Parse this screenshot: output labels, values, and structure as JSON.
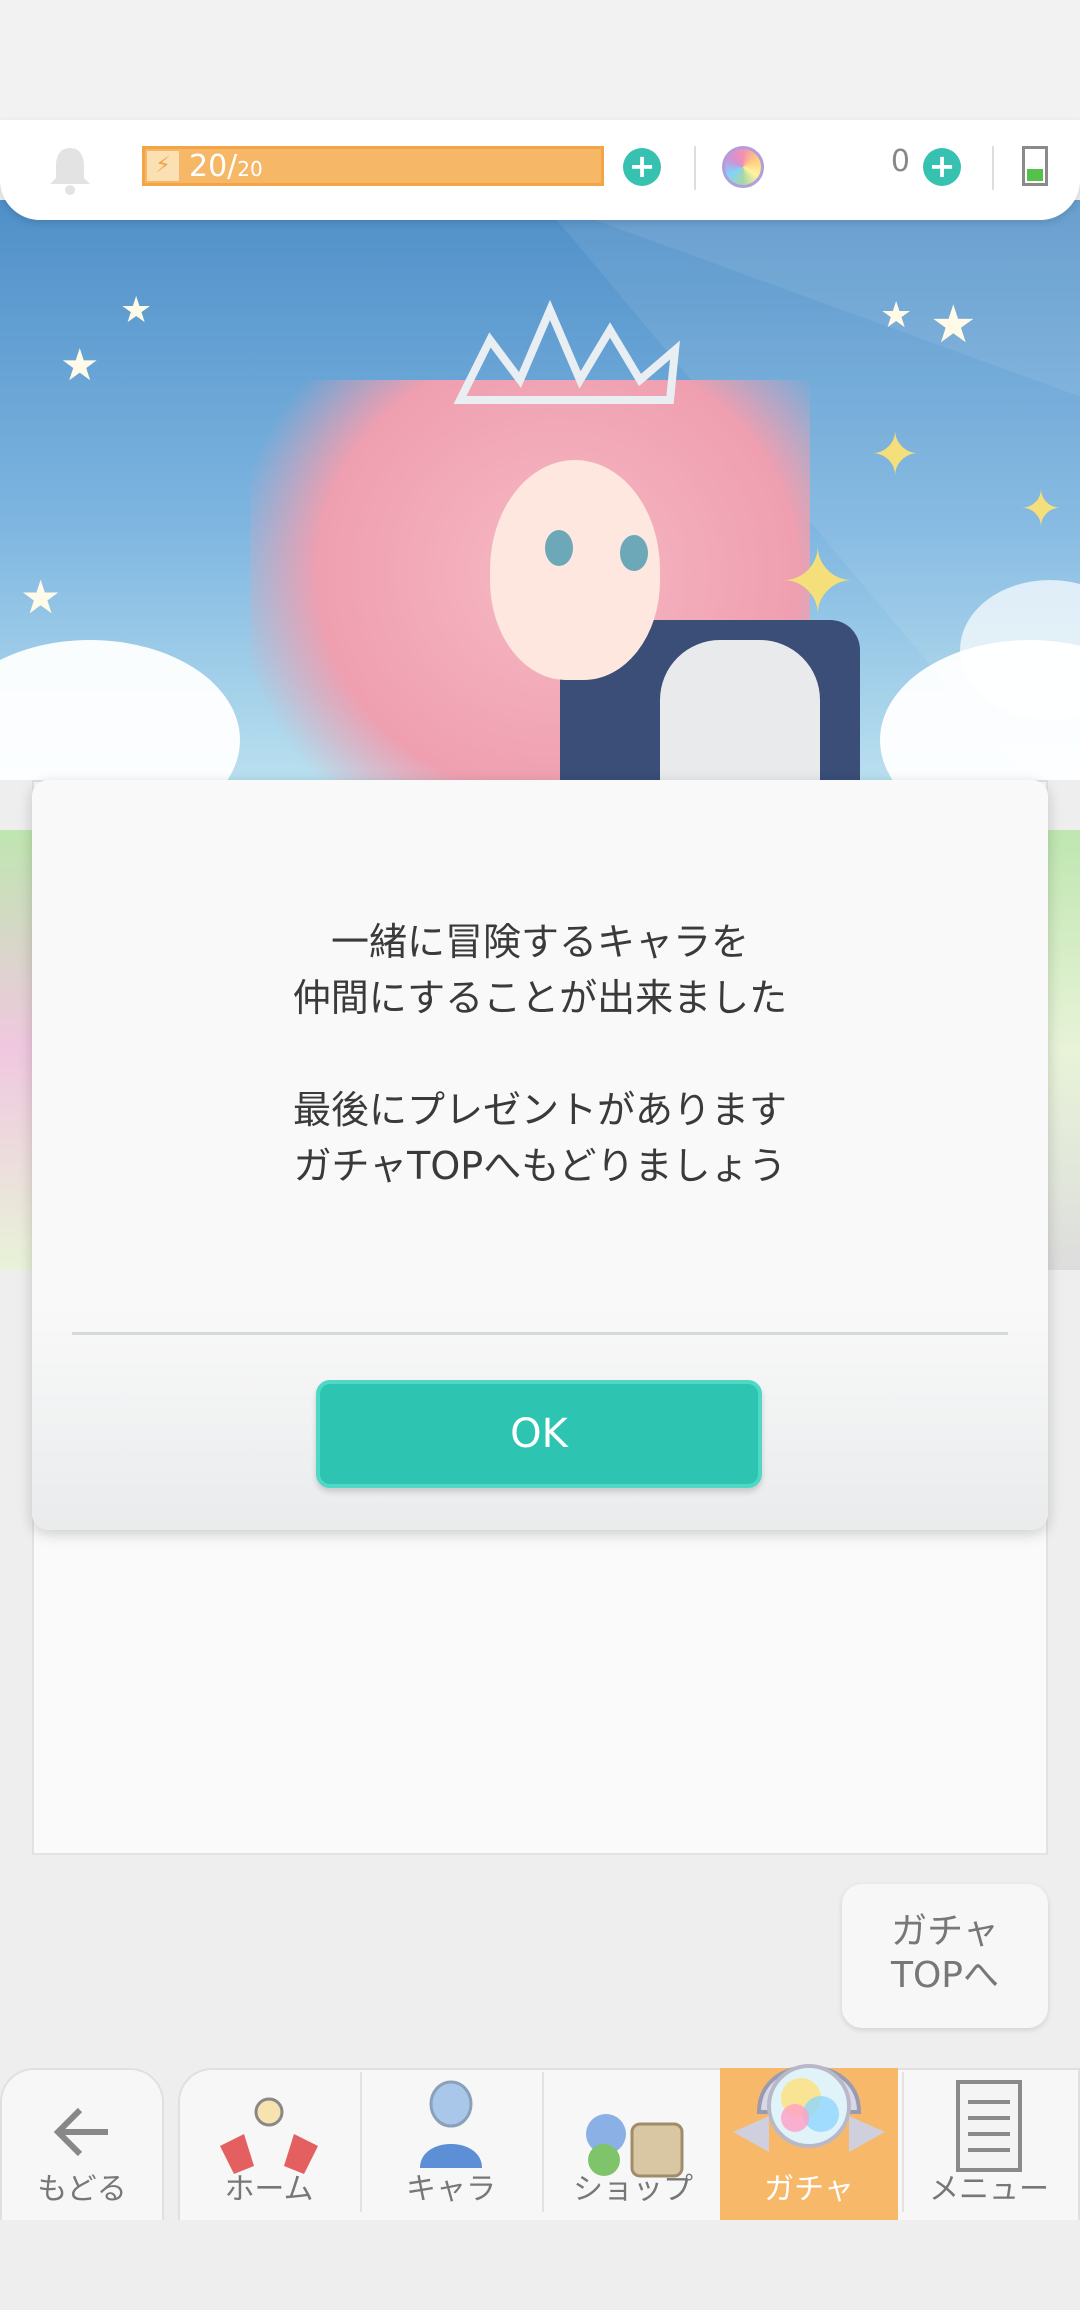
{
  "top_bar": {
    "stamina_current": "20/",
    "stamina_max": "20",
    "gem_count": "0",
    "colors": {
      "stamina": "#f6b766",
      "accent": "#2ec4b2"
    },
    "icons": [
      "bell-icon",
      "bolt-icon",
      "plus-icon",
      "rainbow-gem-icon",
      "battery-icon"
    ]
  },
  "dialog": {
    "lines": [
      "一緒に冒険するキャラを",
      "仲間にすることが出来ました",
      "最後にプレゼントがあります",
      "ガチャTOPへもどりましょう"
    ],
    "ok_label": "OK"
  },
  "gacha_top": {
    "line1": "ガチャ",
    "line2": "TOPへ"
  },
  "bottom_nav": {
    "back": "もどる",
    "items": [
      {
        "label": "ホーム",
        "icon": "home-icon"
      },
      {
        "label": "キャラ",
        "icon": "character-icon"
      },
      {
        "label": "ショップ",
        "icon": "shop-icon"
      },
      {
        "label": "ガチャ",
        "icon": "gacha-orb-icon",
        "active": true
      },
      {
        "label": "メニュー",
        "icon": "menu-list-icon"
      }
    ]
  }
}
